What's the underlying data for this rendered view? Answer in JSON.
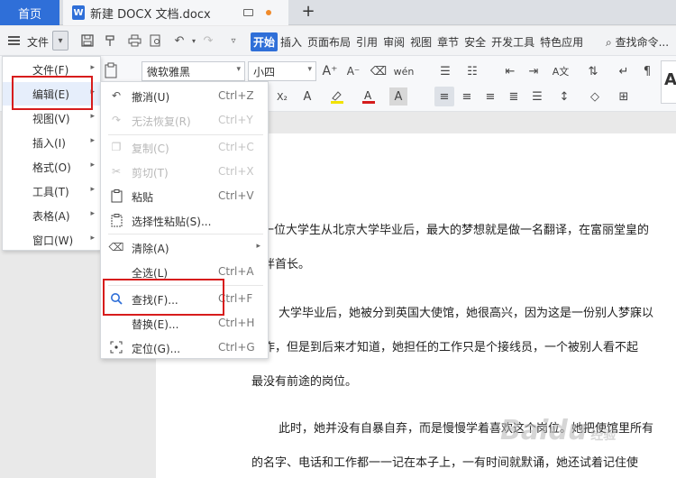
{
  "tabs": {
    "home": "首页",
    "document": "新建 DOCX 文档.docx",
    "doc_icon_letter": "W",
    "new_tab": "+"
  },
  "menu_row": {
    "file_label": "文件",
    "ribbon_tabs": [
      "开始",
      "插入",
      "页面布局",
      "引用",
      "审阅",
      "视图",
      "章节",
      "安全",
      "开发工具",
      "特色应用"
    ],
    "active_tab": "开始",
    "search_commands": "查找命令..."
  },
  "toolbar": {
    "font_name": "微软雅黑",
    "font_size": "小四",
    "style_preview": "A"
  },
  "main_menu": {
    "items": [
      {
        "label": "文件(F)",
        "has_submenu": true
      },
      {
        "label": "编辑(E)",
        "has_submenu": true
      },
      {
        "label": "视图(V)",
        "has_submenu": true
      },
      {
        "label": "插入(I)",
        "has_submenu": true
      },
      {
        "label": "格式(O)",
        "has_submenu": true
      },
      {
        "label": "工具(T)",
        "has_submenu": true
      },
      {
        "label": "表格(A)",
        "has_submenu": true
      },
      {
        "label": "窗口(W)",
        "has_submenu": true
      }
    ]
  },
  "edit_menu": {
    "items": [
      {
        "label": "撤消(U)",
        "shortcut": "Ctrl+Z",
        "icon": "undo-icon",
        "enabled": true
      },
      {
        "label": "无法恢复(R)",
        "shortcut": "Ctrl+Y",
        "icon": "redo-icon",
        "enabled": false
      },
      {
        "label": "复制(C)",
        "shortcut": "Ctrl+C",
        "icon": "copy-icon",
        "enabled": false
      },
      {
        "label": "剪切(T)",
        "shortcut": "Ctrl+X",
        "icon": "cut-icon",
        "enabled": false
      },
      {
        "label": "粘贴",
        "shortcut": "Ctrl+V",
        "icon": "paste-icon",
        "enabled": true
      },
      {
        "label": "选择性粘贴(S)...",
        "shortcut": "",
        "icon": "paste-special-icon",
        "enabled": true
      },
      {
        "label": "清除(A)",
        "shortcut": "",
        "icon": "eraser-icon",
        "enabled": true,
        "has_submenu": true
      },
      {
        "label": "全选(L)",
        "shortcut": "Ctrl+A",
        "icon": "",
        "enabled": true
      },
      {
        "label": "查找(F)...",
        "shortcut": "Ctrl+F",
        "icon": "search-icon",
        "enabled": true
      },
      {
        "label": "替换(E)...",
        "shortcut": "Ctrl+H",
        "icon": "",
        "enabled": true
      },
      {
        "label": "定位(G)...",
        "shortcut": "Ctrl+G",
        "icon": "goto-icon",
        "enabled": true
      }
    ]
  },
  "document": {
    "lines": [
      "一位大学生从北京大学毕业后，最大的梦想就是做一名翻译，在富丽堂皇的",
      "陪伴首长。",
      "大学毕业后，她被分到英国大使馆，她很高兴，因为这是一份别人梦寐以",
      "工作，但是到后来才知道，她担任的工作只是个接线员，一个被别人看不起",
      "最没有前途的岗位。",
      "此时，她并没有自暴自弃，而是慢慢学着喜欢这个岗位。她把使馆里所有",
      "的名字、电话和工作都一一记在本子上，一有时间就默诵，她还试着记住使"
    ]
  },
  "watermark": {
    "text": "Baidu",
    "suffix": "经验"
  }
}
